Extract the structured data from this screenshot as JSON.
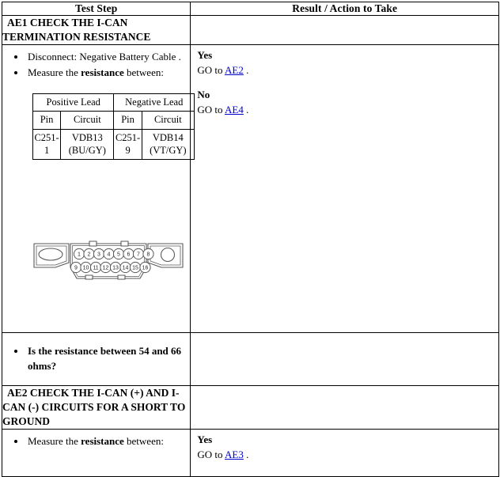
{
  "table": {
    "headers": {
      "step": "Test Step",
      "result": "Result / Action to Take"
    }
  },
  "tests": [
    {
      "id": "AE1",
      "title": "AE1 CHECK THE I-CAN TERMINATION RESISTANCE",
      "steps": [
        {
          "text_before": "Disconnect: Negative Battery Cable .",
          "bold_part": "",
          "text_after": ""
        },
        {
          "text_before": "Measure the ",
          "bold_part": "resistance",
          "text_after": " between:"
        }
      ],
      "lead_table": {
        "group_headers": [
          "Positive Lead",
          "Negative Lead"
        ],
        "sub_headers": [
          "Pin",
          "Circuit",
          "Pin",
          "Circuit"
        ],
        "rows": [
          [
            "C251-1",
            "VDB13 (BU/GY)",
            "C251-9",
            "VDB14 (VT/GY)"
          ]
        ]
      },
      "connector": {
        "name": "obd-16-pin-connector",
        "pins_top": [
          "1",
          "2",
          "3",
          "4",
          "5",
          "6",
          "7",
          "8"
        ],
        "pins_bottom": [
          "9",
          "10",
          "11",
          "12",
          "13",
          "14",
          "15",
          "16"
        ]
      },
      "question": "Is the resistance between 54 and 66 ohms?",
      "results": [
        {
          "label": "Yes",
          "action_prefix": "GO to ",
          "link": "AE2",
          "action_suffix": " ."
        },
        {
          "label": "No",
          "action_prefix": "GO to ",
          "link": "AE4",
          "action_suffix": " ."
        }
      ]
    },
    {
      "id": "AE2",
      "title": "AE2 CHECK THE I-CAN (+) AND I-CAN (-) CIRCUITS FOR A SHORT TO GROUND",
      "steps": [
        {
          "text_before": "Measure the ",
          "bold_part": "resistance",
          "text_after": " between:"
        }
      ],
      "results": [
        {
          "label": "Yes",
          "action_prefix": "GO to ",
          "link": "AE3",
          "action_suffix": " ."
        }
      ]
    }
  ],
  "colors": {
    "link": "#0000cc",
    "border": "#000000",
    "text": "#000000",
    "background": "#ffffff"
  }
}
